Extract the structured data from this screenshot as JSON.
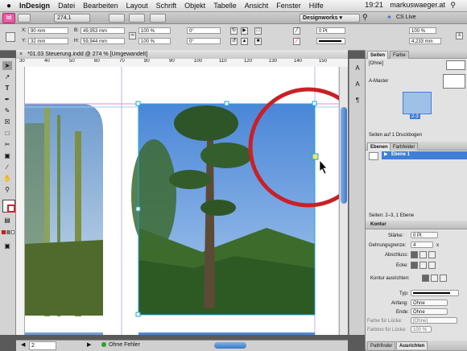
{
  "menubar": {
    "app": "InDesign",
    "items": [
      "Datei",
      "Bearbeiten",
      "Layout",
      "Schrift",
      "Objekt",
      "Tabelle",
      "Ansicht",
      "Fenster",
      "Hilfe"
    ],
    "time": "19:21",
    "user": "markuswaeger.at"
  },
  "appbar": {
    "zoom": "274,1",
    "workspace": "Designworks",
    "cslive": "CS Live"
  },
  "control": {
    "x": "90 mm",
    "y": "32 mm",
    "w": "49,953 mm",
    "h": "59,944 mm",
    "scale_x": "100 %",
    "scale_y": "100 %",
    "rotation": "0°",
    "shear": "0°",
    "stroke_weight": "0 Pt",
    "opacity": "100 %",
    "gap": "4,233 mm"
  },
  "document": {
    "tab_title": "*01.03 Steuerung.indd @ 274 % [Umgewandelt]",
    "ruler_labels": [
      "30",
      "40",
      "50",
      "60",
      "70",
      "80",
      "90",
      "100",
      "110",
      "120",
      "130",
      "140",
      "150"
    ],
    "page_number": "2",
    "preflight": "Ohne Fehler"
  },
  "pages_panel": {
    "tabs": [
      "Seiten",
      "Farbe"
    ],
    "none_master": "[Ohne]",
    "a_master": "A-Master",
    "spread_label": "2-3",
    "footer": "Seiten auf 1 Druckbogen"
  },
  "layers_panel": {
    "tabs": [
      "Ebenen",
      "Farbfelder"
    ],
    "layer_name": "Ebene 1",
    "footer": "Seiten: 2–3, 1 Ebene"
  },
  "stroke_panel": {
    "title": "Kontur",
    "weight_label": "Stärke:",
    "weight_value": "0 Pt",
    "miter_label": "Gehrungsgrenze:",
    "miter_value": "4",
    "miter_unit": "x",
    "cap_label": "Abschluss:",
    "join_label": "Ecke:",
    "align_label": "Kontur ausrichten:",
    "type_label": "Typ:",
    "start_label": "Anfang:",
    "start_value": "Ohne",
    "end_label": "Ende:",
    "end_value": "Ohne",
    "gap_color_label": "Farbe für Lücke:",
    "gap_color_value": "[Ohne]",
    "gap_tint_label": "Farbton für Lücke:",
    "gap_tint_value": "100 %"
  },
  "bottom_tabs": [
    "Pathfinder",
    "Ausrichten"
  ],
  "colors": {
    "accent": "#3f7fd6",
    "frame": "#1aa6d8",
    "highlight": "#d4202a"
  }
}
